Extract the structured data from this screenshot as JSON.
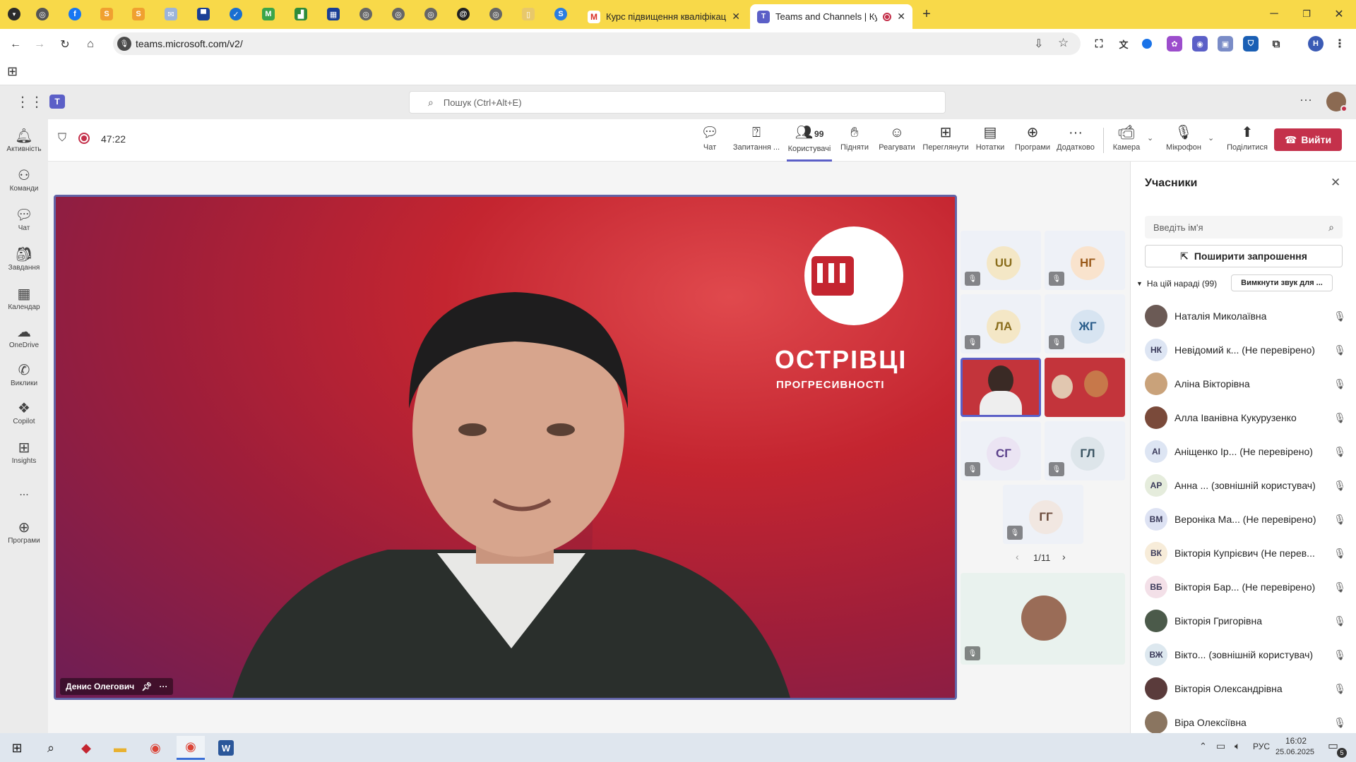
{
  "browser": {
    "tabs": [
      {
        "title": "Курс підвищення кваліфікації",
        "active": false
      },
      {
        "title": "Teams and Channels | Курс",
        "active": true
      }
    ],
    "new_tab": "+",
    "url": "teams.microsoft.com/v2/",
    "profile_initial": "Н"
  },
  "teams": {
    "search_placeholder": "Пошук (Ctrl+Alt+E)",
    "rail": [
      {
        "label": "Активність",
        "icon": "bell-icon"
      },
      {
        "label": "Команди",
        "icon": "teams-icon"
      },
      {
        "label": "Чат",
        "icon": "chat-icon"
      },
      {
        "label": "Завдання",
        "icon": "assignments-icon"
      },
      {
        "label": "Календар",
        "icon": "calendar-icon"
      },
      {
        "label": "OneDrive",
        "icon": "cloud-icon"
      },
      {
        "label": "Виклики",
        "icon": "phone-icon"
      },
      {
        "label": "Copilot",
        "icon": "copilot-icon"
      },
      {
        "label": "Insights",
        "icon": "insights-icon"
      },
      {
        "label": "...",
        "icon": "more-icon"
      },
      {
        "label": "Програми",
        "icon": "apps-icon"
      }
    ]
  },
  "meeting": {
    "timer": "47:22",
    "buttons": {
      "chat": "Чат",
      "qa": "Запитання ...",
      "people": "Користувачі",
      "people_count": "99",
      "raise": "Підняти",
      "react": "Реагувати",
      "view": "Переглянути",
      "notes": "Нотатки",
      "apps": "Програми",
      "more": "Додатково",
      "camera": "Камера",
      "mic": "Мікрофон",
      "share": "Поділитися",
      "leave": "Вийти"
    },
    "speaker_name": "Денис Олегович",
    "logo_line1": "ОСТРІВЦІ",
    "logo_line2": "ПРОГРЕСИВНОСТІ",
    "tiles": [
      "UU",
      "НГ",
      "ЛА",
      "ЖГ",
      "СГ",
      "ГЛ",
      "ГГ"
    ],
    "pager": "1/11"
  },
  "panel": {
    "title": "Учасники",
    "search_placeholder": "Введіть ім'я",
    "share_invite": "Поширити запрошення",
    "section": "На цій нараді (99)",
    "mute_all": "Вимкнути звук для ...",
    "participants": [
      {
        "name": "Наталія Миколаївна",
        "initials": "",
        "color": "#6b5a55"
      },
      {
        "name": "Невідомий к... (Не перевірено)",
        "initials": "НК",
        "color": "#dde5f3"
      },
      {
        "name": "Аліна Вікторівна",
        "initials": "",
        "color": "#c9a27a"
      },
      {
        "name": "Алла Іванівна Кукурузенко",
        "initials": "",
        "color": "#7a4a3a"
      },
      {
        "name": "Аніщенко Ір... (Не перевірено)",
        "initials": "АІ",
        "color": "#dde5f3"
      },
      {
        "name": "Анна ... (зовнішній користувач)",
        "initials": "АР",
        "color": "#e5ecdc"
      },
      {
        "name": "Вероніка Ма... (Не перевірено)",
        "initials": "ВМ",
        "color": "#dde2f3"
      },
      {
        "name": "Вікторія Купрієвич (Не перев...",
        "initials": "ВК",
        "color": "#f7ecd9"
      },
      {
        "name": "Вікторія Бар... (Не перевірено)",
        "initials": "ВБ",
        "color": "#f3e0e8"
      },
      {
        "name": "Вікторія Григорівна",
        "initials": "",
        "color": "#4b5a4a"
      },
      {
        "name": "Вікто... (зовнішній користувач)",
        "initials": "ВЖ",
        "color": "#dde8ef"
      },
      {
        "name": "Вікторія Олександрівна",
        "initials": "",
        "color": "#5a3b3b"
      },
      {
        "name": "Віра Олексіївна",
        "initials": "",
        "color": "#8a7560"
      }
    ]
  },
  "taskbar": {
    "lang": "РУС",
    "time": "16:02",
    "date": "25.06.2025",
    "notif_count": "5"
  }
}
